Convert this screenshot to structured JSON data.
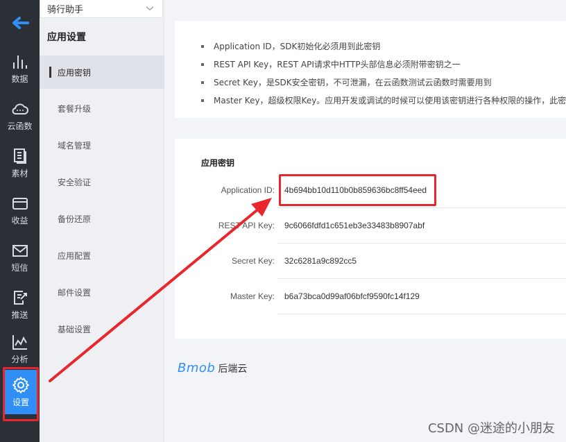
{
  "rail": {
    "items": [
      {
        "label": "数据",
        "icon": "bar-chart-icon"
      },
      {
        "label": "云函数",
        "icon": "cloud-icon"
      },
      {
        "label": "素材",
        "icon": "document-icon"
      },
      {
        "label": "收益",
        "icon": "card-icon"
      },
      {
        "label": "短信",
        "icon": "mail-icon"
      },
      {
        "label": "推送",
        "icon": "push-icon"
      },
      {
        "label": "分析",
        "icon": "line-chart-icon"
      },
      {
        "label": "设置",
        "icon": "gear-icon"
      }
    ],
    "active_color": "#2f8ff6"
  },
  "app_select": {
    "value": "骑行助手"
  },
  "subnav": {
    "title": "应用设置",
    "items": [
      {
        "label": "应用密钥"
      },
      {
        "label": "套餐升级"
      },
      {
        "label": "域名管理"
      },
      {
        "label": "安全验证"
      },
      {
        "label": "备份还原"
      },
      {
        "label": "应用配置"
      },
      {
        "label": "邮件设置"
      },
      {
        "label": "基础设置"
      }
    ]
  },
  "info": {
    "bullets": [
      "Application ID，SDK初始化必须用到此密钥",
      "REST API Key，REST API请求中HTTP头部信息必须附带密钥之一",
      "Secret Key，是SDK安全密钥，不可泄漏，在云函数测试云函数时需要用到",
      "Master Key，超级权限Key。应用开发或调试的时候可以使用该密钥进行各种权限的操作，此密钥"
    ]
  },
  "keys": {
    "title": "应用密钥",
    "rows": [
      {
        "label": "Application ID:",
        "value": "4b694bb10d110b0b859636bc8ff54eed"
      },
      {
        "label": "REST API Key:",
        "value": "9c6066fdfd1c651eb3e33483b8907abf"
      },
      {
        "label": "Secret Key:",
        "value": "32c6281a9c892cc5"
      },
      {
        "label": "Master Key:",
        "value": "b6a73bca0d99af06bfcf9590fc14f129"
      }
    ]
  },
  "brand": {
    "logo": "Bmob",
    "text": "后端云"
  },
  "watermark": "CSDN @迷途的小朋友",
  "annotation_color": "#e8262b"
}
